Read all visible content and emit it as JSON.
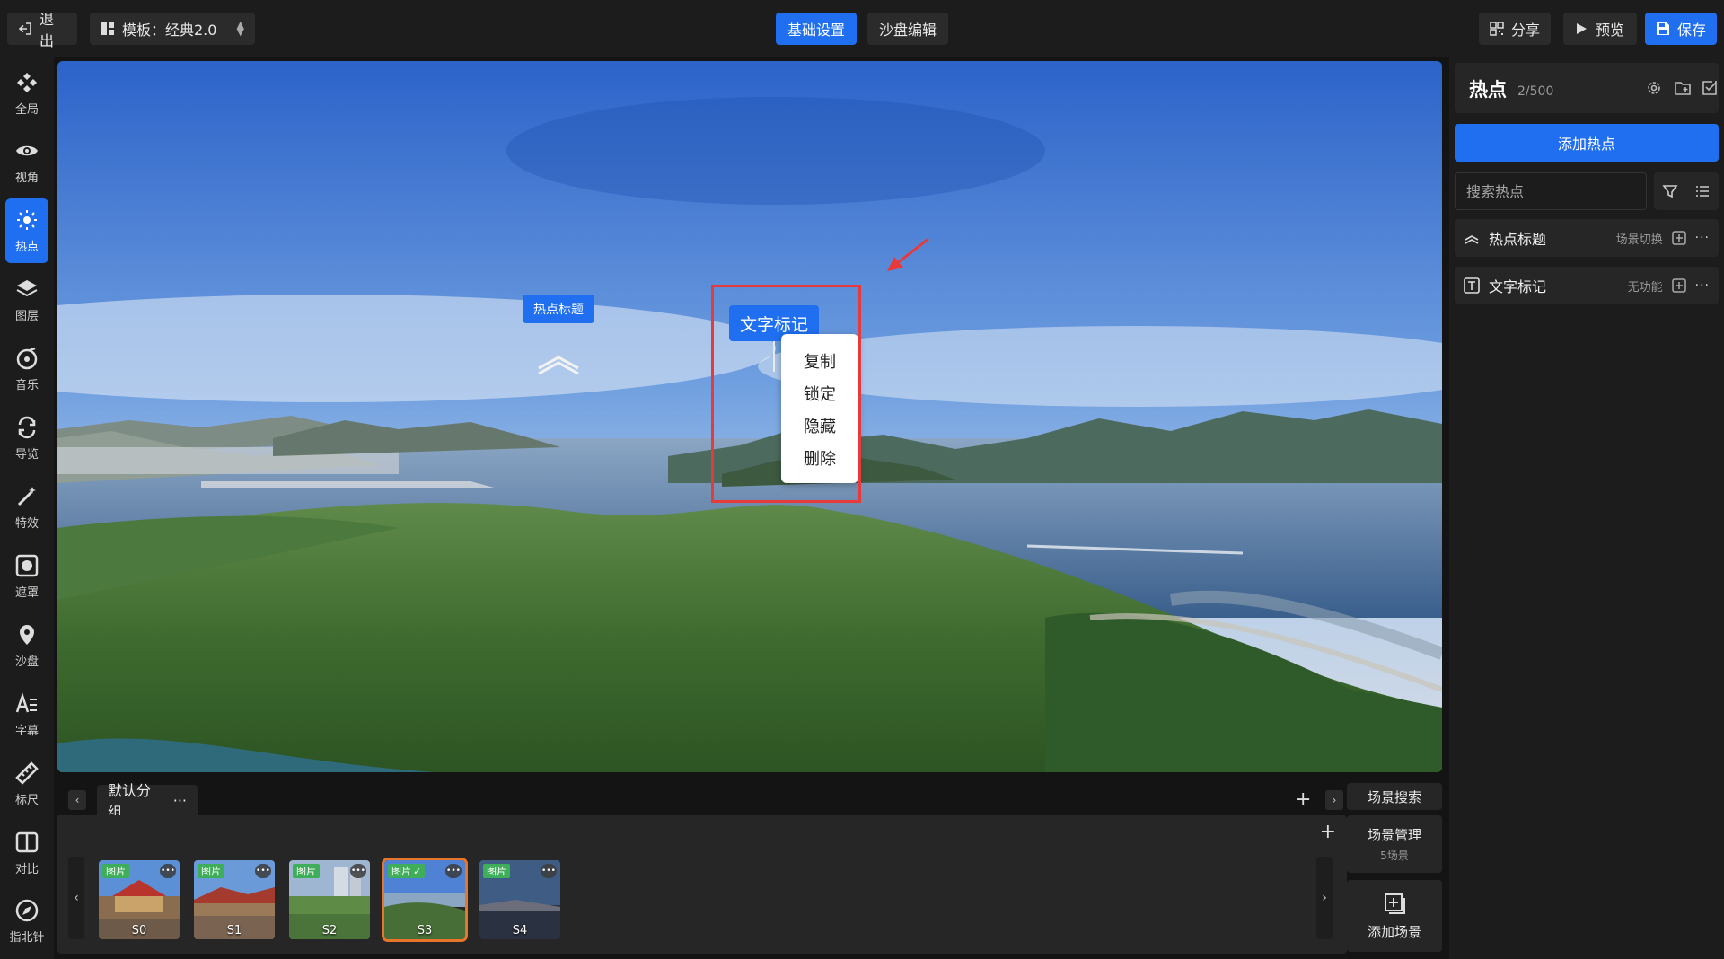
{
  "topbar": {
    "exit_label": "退出",
    "template_label": "模板：经典2.0",
    "tabs": [
      {
        "label": "基础设置",
        "active": true
      },
      {
        "label": "沙盘编辑",
        "active": false
      }
    ],
    "share_label": "分享",
    "preview_label": "预览",
    "save_label": "保存"
  },
  "sidebar": {
    "items": [
      {
        "label": "全局",
        "icon": "global-icon"
      },
      {
        "label": "视角",
        "icon": "eye-icon"
      },
      {
        "label": "热点",
        "icon": "hotspot-icon",
        "active": true
      },
      {
        "label": "图层",
        "icon": "layers-icon"
      },
      {
        "label": "音乐",
        "icon": "music-icon"
      },
      {
        "label": "导览",
        "icon": "tour-icon"
      },
      {
        "label": "特效",
        "icon": "effects-icon"
      },
      {
        "label": "遮罩",
        "icon": "mask-icon"
      },
      {
        "label": "沙盘",
        "icon": "map-pin-icon"
      },
      {
        "label": "字幕",
        "icon": "subtitle-icon"
      },
      {
        "label": "标尺",
        "icon": "ruler-icon"
      },
      {
        "label": "对比",
        "icon": "compare-icon"
      },
      {
        "label": "指北针",
        "icon": "compass-icon"
      }
    ]
  },
  "viewport": {
    "hotspot_label": "热点标题",
    "text_mark_label": "文字标记",
    "context_menu": [
      "复制",
      "锁定",
      "隐藏",
      "删除"
    ]
  },
  "panel": {
    "title": "热点",
    "count": "2/500",
    "add_button": "添加热点",
    "search_placeholder": "搜索热点",
    "items": [
      {
        "name": "热点标题",
        "function": "场景切换",
        "icon": "chevron-up-icon"
      },
      {
        "name": "文字标记",
        "function": "无功能",
        "icon": "text-box-icon"
      }
    ]
  },
  "scenes": {
    "group_name": "默认分组",
    "tag_label": "图片",
    "thumbs": [
      {
        "name": "S0"
      },
      {
        "name": "S1"
      },
      {
        "name": "S2"
      },
      {
        "name": "S3",
        "active": true
      },
      {
        "name": "S4"
      }
    ],
    "search_label": "场景搜索",
    "manage_label": "场景管理",
    "manage_count": "5场景",
    "add_scene_label": "添加场景"
  },
  "colors": {
    "accent": "#1f6ff0",
    "panel_bg": "#1c1c1c",
    "annotation_red": "#e83a3a",
    "active_thumb_border": "#e8762a"
  }
}
